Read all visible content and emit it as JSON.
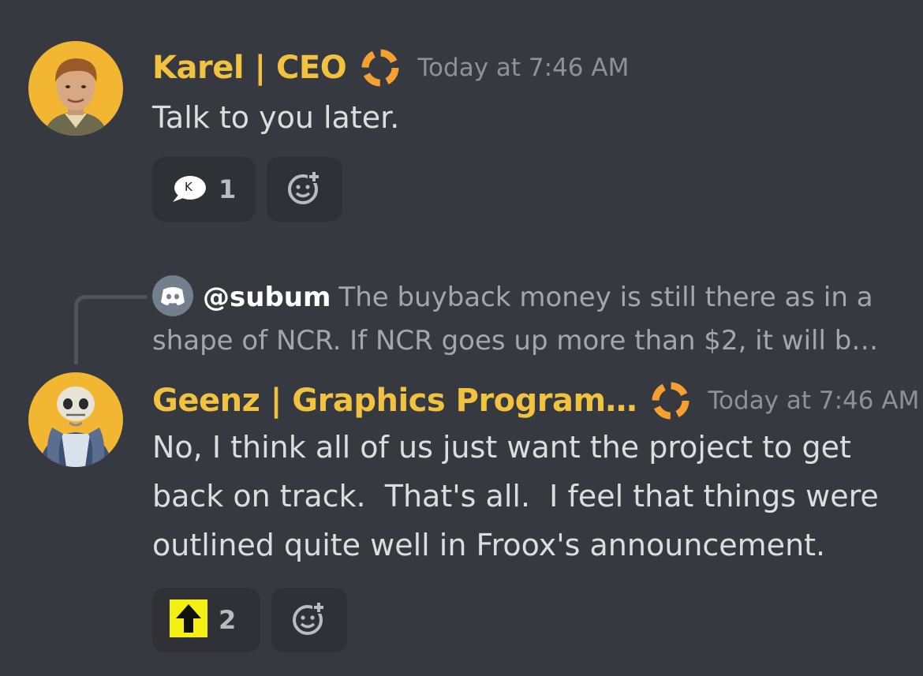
{
  "messages": [
    {
      "username": "Karel | CEO",
      "timestamp": "Today at 7:46 AM",
      "content": "Talk to you later.",
      "reactions": [
        {
          "emoji_name": "speech-bubble-k-icon",
          "emoji_text": "K",
          "count": "1"
        }
      ]
    },
    {
      "reply": {
        "author": "@subum",
        "text": "The buyback money is still there as in a shape of NCR. If NCR goes up more than $2, it will b…"
      },
      "username": "Geenz | Graphics Program…",
      "timestamp": "Today at 7:46 AM",
      "content": "No, I think all of us just want the project to get back on track.  That's all.  I feel that things were outlined quite well in Froox's announcement.",
      "reactions": [
        {
          "emoji_name": "up-arrow-icon",
          "count": "2"
        }
      ]
    }
  ],
  "colors": {
    "background": "#36393f",
    "username": "#f0c240",
    "role_icon": "#f5a030",
    "timestamp": "#8e9297",
    "text": "#dcddde",
    "reaction_bg": "#2f3136",
    "reply_text": "#a3a6aa"
  }
}
